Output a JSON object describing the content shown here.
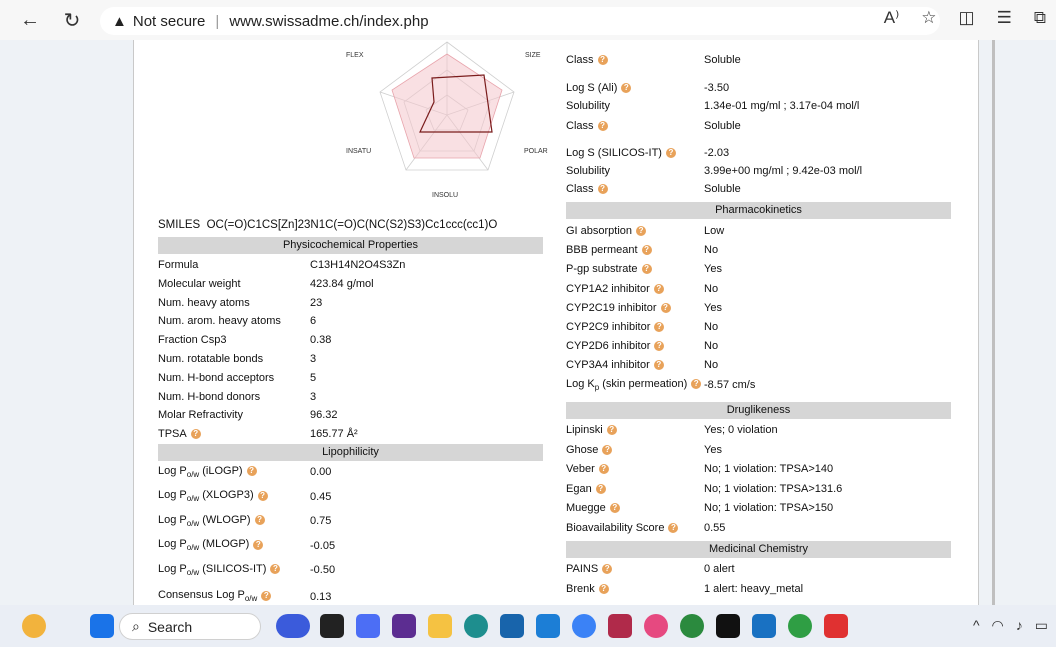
{
  "browser": {
    "security": "Not secure",
    "url": "www.swissadme.ch/index.php"
  },
  "radar": {
    "labels": {
      "flex": "FLEX",
      "size": "SIZE",
      "insatu": "INSATU",
      "polar": "POLAR",
      "insolu": "INSOLU"
    }
  },
  "smiles": {
    "label": "SMILES",
    "value": "OC(=O)C1CS[Zn]23N1C(=O)C(NC(S2)S3)Cc1ccc(cc1)O"
  },
  "physchem": {
    "header": "Physicochemical Properties",
    "rows": [
      {
        "label": "Formula",
        "value": "C13H14N2O4S3Zn"
      },
      {
        "label": "Molecular weight",
        "value": "423.84 g/mol"
      },
      {
        "label": "Num. heavy atoms",
        "value": "23"
      },
      {
        "label": "Num. arom. heavy atoms",
        "value": "6"
      },
      {
        "label": "Fraction Csp3",
        "value": "0.38"
      },
      {
        "label": "Num. rotatable bonds",
        "value": "3"
      },
      {
        "label": "Num. H-bond acceptors",
        "value": "5"
      },
      {
        "label": "Num. H-bond donors",
        "value": "3"
      },
      {
        "label": "Molar Refractivity",
        "value": "96.32"
      },
      {
        "label": "TPSA",
        "value": "165.77 Å²"
      }
    ]
  },
  "lipo": {
    "header": "Lipophilicity",
    "logp": "Log P",
    "ow": "o/w",
    "rows": [
      {
        "method": "(iLOGP)",
        "value": "0.00"
      },
      {
        "method": "(XLOGP3)",
        "value": "0.45"
      },
      {
        "method": "(WLOGP)",
        "value": "0.75"
      },
      {
        "method": "(MLOGP)",
        "value": "-0.05"
      },
      {
        "method": "(SILICOS-IT)",
        "value": "-0.50"
      }
    ],
    "consensus_label": "Consensus Log P",
    "consensus_value": "0.13"
  },
  "solubility": {
    "class1_label": "Class",
    "class1_value": "Soluble",
    "logs_ali_label": "Log S (Ali)",
    "logs_ali_value": "-3.50",
    "sol_ali_label": "Solubility",
    "sol_ali_value": "1.34e-01 mg/ml ; 3.17e-04 mol/l",
    "class2_label": "Class",
    "class2_value": "Soluble",
    "logs_sil_label": "Log S (SILICOS-IT)",
    "logs_sil_value": "-2.03",
    "sol_sil_label": "Solubility",
    "sol_sil_value": "3.99e+00 mg/ml ; 9.42e-03 mol/l",
    "class3_label": "Class",
    "class3_value": "Soluble"
  },
  "pk": {
    "header": "Pharmacokinetics",
    "rows": [
      {
        "label": "GI absorption",
        "value": "Low"
      },
      {
        "label": "BBB permeant",
        "value": "No"
      },
      {
        "label": "P-gp substrate",
        "value": "Yes"
      },
      {
        "label": "CYP1A2 inhibitor",
        "value": "No"
      },
      {
        "label": "CYP2C19 inhibitor",
        "value": "Yes"
      },
      {
        "label": "CYP2C9 inhibitor",
        "value": "No"
      },
      {
        "label": "CYP2D6 inhibitor",
        "value": "No"
      },
      {
        "label": "CYP3A4 inhibitor",
        "value": "No"
      }
    ],
    "kp_label": "Log Kp (skin permeation)",
    "kp_value": "-8.57 cm/s"
  },
  "druglike": {
    "header": "Druglikeness",
    "rows": [
      {
        "label": "Lipinski",
        "value": "Yes; 0 violation"
      },
      {
        "label": "Ghose",
        "value": "Yes"
      },
      {
        "label": "Veber",
        "value": "No; 1 violation: TPSA>140"
      },
      {
        "label": "Egan",
        "value": "No; 1 violation: TPSA>131.6"
      },
      {
        "label": "Muegge",
        "value": "No; 1 violation: TPSA>150"
      },
      {
        "label": "Bioavailability Score",
        "value": "0.55"
      }
    ]
  },
  "medchem": {
    "header": "Medicinal Chemistry",
    "rows": [
      {
        "label": "PAINS",
        "value": "0 alert"
      },
      {
        "label": "Brenk",
        "value": "1 alert: heavy_metal"
      }
    ]
  },
  "taskbar": {
    "search": "Search"
  }
}
